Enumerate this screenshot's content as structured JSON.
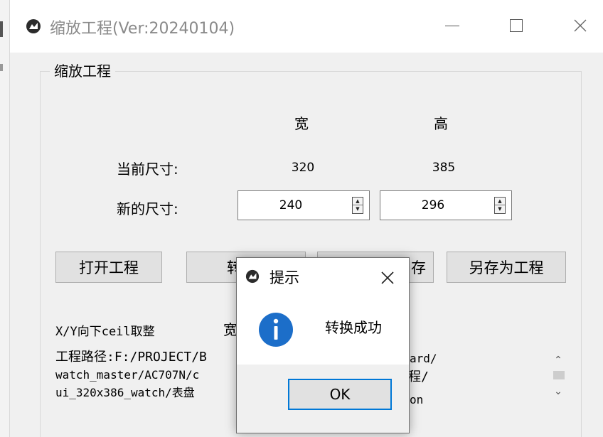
{
  "window": {
    "title": "缩放工程(Ver:20240104)"
  },
  "group": {
    "label": "缩放工程",
    "col_width_header": "宽",
    "col_height_header": "高",
    "current_size_label": "当前尺寸:",
    "current_width": "320",
    "current_height": "385",
    "new_size_label": "新的尺寸:",
    "new_width": "240",
    "new_height": "296"
  },
  "buttons": {
    "open_project": "打开工程",
    "convert": "转",
    "save": "存",
    "save_as_project": "另存为工程"
  },
  "status": {
    "rounding": "X/Y向下ceil取整",
    "width_note": "宽"
  },
  "path": {
    "lines": [
      "工程路径:F:/PROJECT/B",
      "watch_master/AC707N/c",
      "ui_320x386_watch/表盘"
    ],
    "right_fragments": [
      "ard/",
      "程/",
      "on"
    ]
  },
  "dialog": {
    "title": "提示",
    "message": "转换成功",
    "ok_label": "OK"
  },
  "colors": {
    "accent": "#0078d7",
    "info_icon": "#1c6ec9"
  }
}
